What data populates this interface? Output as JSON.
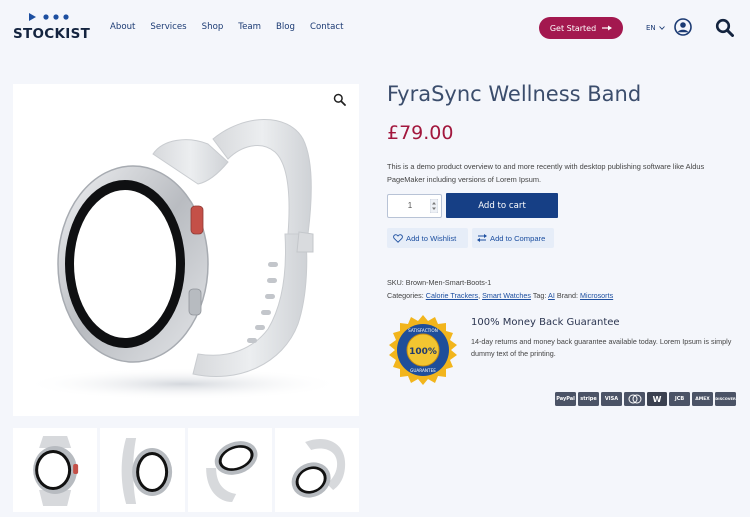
{
  "brand": {
    "name": "STOCKIST"
  },
  "nav": {
    "items": [
      "About",
      "Services",
      "Shop",
      "Team",
      "Blog",
      "Contact"
    ]
  },
  "header": {
    "cta_label": "Get Started",
    "language": "EN"
  },
  "product": {
    "title": "FyraSync Wellness Band",
    "price": "£79.00",
    "description": "This is a demo product overview to and more recently with desktop publishing software like Aldus PageMaker including versions of Lorem Ipsum.",
    "quantity": "1",
    "add_to_cart_label": "Add to cart",
    "wishlist_label": "Add to Wishlist",
    "compare_label": "Add to Compare",
    "sku_label": "SKU:",
    "sku": "Brown-Men-Smart-Boots-1",
    "categories_label": "Categories:",
    "categories": [
      "Calorie Trackers",
      "Smart Watches"
    ],
    "tag_label": "Tag:",
    "tag": "AI",
    "brand_label": "Brand:",
    "brand": "Microsorts"
  },
  "guarantee": {
    "title": "100% Money Back Guarantee",
    "text": "14-day returns and money back guarantee available today. Lorem Ipsum is simply dummy text of the printing.",
    "badge_text": "SATISFACTION 100% GUARANTEE"
  },
  "payments": [
    "PayPal",
    "stripe",
    "VISA",
    "mastercard",
    "W",
    "JCB",
    "AMEX",
    "DISCOVER"
  ],
  "colors": {
    "brand": "#14243f",
    "nav": "#1b3a73",
    "cta": "#a3184f",
    "price": "#a2173d",
    "button": "#163f85",
    "link": "#1d4fa0"
  },
  "icons": {
    "user": "user-circle-icon",
    "search": "search-icon",
    "zoom": "zoom-icon",
    "wishlist": "heart-icon",
    "compare": "compare-arrows-icon"
  }
}
